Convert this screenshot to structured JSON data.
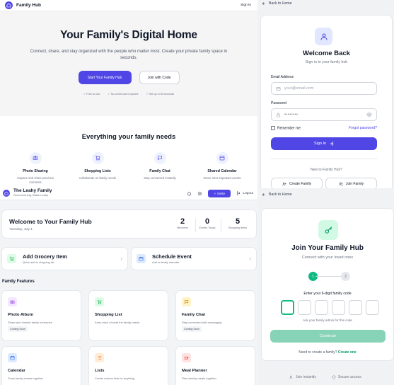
{
  "landing": {
    "brand": "Family Hub",
    "signin": "Sign In",
    "title": "Your Family's Digital Home",
    "subtitle": "Connect, share, and stay organized with the people who matter most. Create your private family space in seconds.",
    "cta_primary": "Start Your Family Hub",
    "cta_secondary": "Join with Code",
    "perks": [
      "Free to use",
      "No credit card required",
      "Set up in 60 seconds"
    ],
    "features_title": "Everything your family needs",
    "features": [
      {
        "title": "Photo Sharing",
        "desc": "Capture and share precious moments",
        "icon": "camera-icon"
      },
      {
        "title": "Shopping Lists",
        "desc": "Collaborate on family needs",
        "icon": "cart-icon"
      },
      {
        "title": "Family Chat",
        "desc": "Stay connected instantly",
        "icon": "chat-icon"
      },
      {
        "title": "Shared Calendar",
        "desc": "Never miss important events",
        "icon": "calendar-icon"
      }
    ]
  },
  "login": {
    "back": "Back to Home",
    "title": "Welcome Back",
    "subtitle": "Sign in to your family hub",
    "email_label": "Email Address",
    "email_placeholder": "your@email.com",
    "password_label": "Password",
    "password_value": "••••••••",
    "remember": "Remember me",
    "forgot": "Forgot password?",
    "submit": "Sign In",
    "new_prompt": "New to Family Hub?",
    "create": "Create Family",
    "join": "Join Family"
  },
  "dashboard": {
    "family_name": "The Leahy Family",
    "greeting": "Good evening, Blake Leahy",
    "invite": "Invite",
    "logout": "Logout",
    "welcome_title": "Welcome to Your Family Hub",
    "date": "Tuesday, July 1",
    "stats": [
      {
        "value": "2",
        "label": "Members"
      },
      {
        "value": "0",
        "label": "Events Today"
      },
      {
        "value": "5",
        "label": "Shopping Items"
      }
    ],
    "quick_actions": [
      {
        "title": "Add Grocery Item",
        "desc": "Quick add to shopping list"
      },
      {
        "title": "Schedule Event",
        "desc": "Add to family calendar"
      }
    ],
    "features_title": "Family Features",
    "features": [
      {
        "title": "Photo Album",
        "desc": "Share and cherish family memories",
        "badge": "Coming Soon"
      },
      {
        "title": "Shopping List",
        "desc": "Keep track of what the family needs",
        "badge": ""
      },
      {
        "title": "Family Chat",
        "desc": "Stay connected with messaging",
        "badge": "Coming Soon"
      },
      {
        "title": "Calendar",
        "desc": "Track family events together",
        "badge": ""
      },
      {
        "title": "Lists",
        "desc": "Create custom lists for anything",
        "badge": ""
      },
      {
        "title": "Meal Planner",
        "desc": "Plan weekly meals together",
        "badge": ""
      }
    ]
  },
  "join": {
    "back": "Back to Home",
    "title": "Join Your Family Hub",
    "subtitle": "Connect with your loved ones",
    "step1": "1",
    "step2": "2",
    "code_label": "Enter your 6-digit family code",
    "code_hint": "Ask your family admin for this code",
    "continue": "Continue",
    "need_prompt": "Need to create a family?",
    "create_link": "Create one",
    "footer_left": "Join instantly",
    "footer_right": "Secure access"
  },
  "colors": {
    "primary": "#4f46e5",
    "green": "#10b981",
    "green_light": "#86d3b7"
  }
}
